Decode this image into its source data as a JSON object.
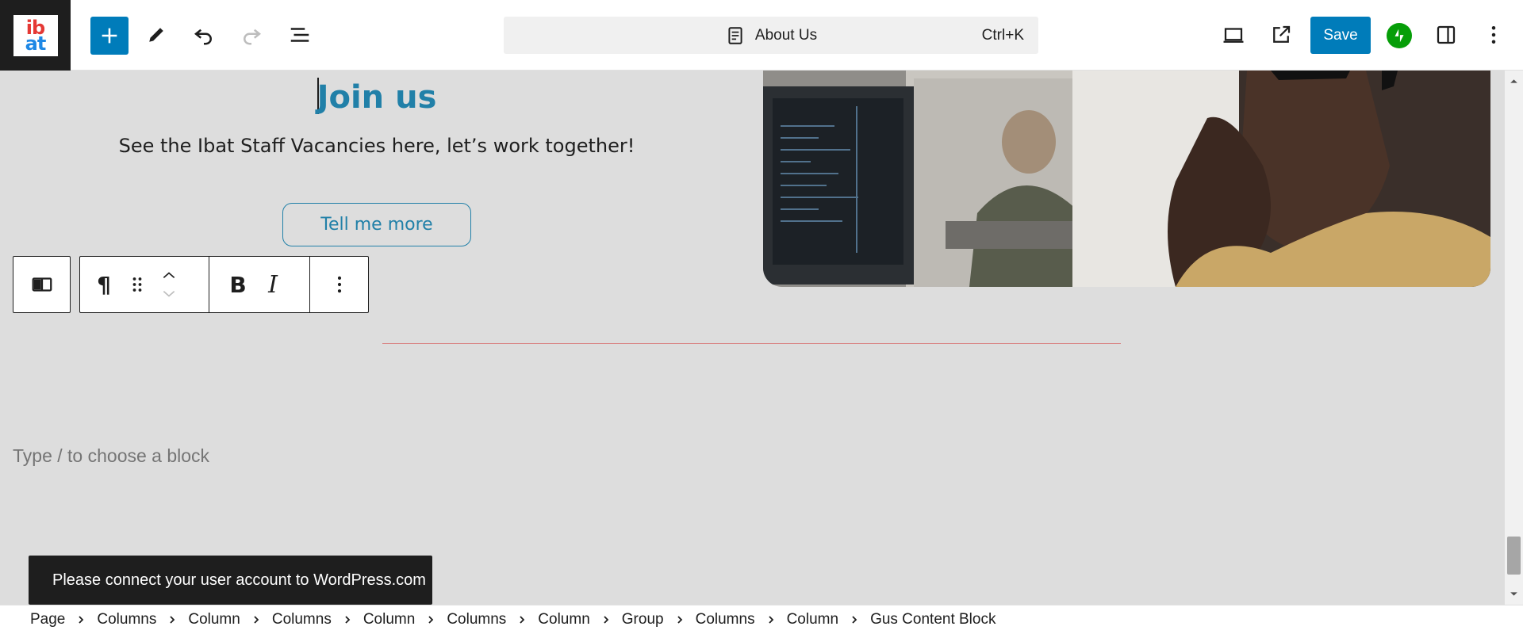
{
  "header": {
    "logo_text_top": "ib",
    "logo_text_bottom": "at",
    "add_block_icon": "plus-icon",
    "tools_icon": "pencil-icon",
    "undo_icon": "undo-icon",
    "redo_icon": "redo-icon",
    "document_overview_icon": "list-view-icon",
    "document_title": "About Us",
    "shortcut": "Ctrl+K",
    "view_icon": "desktop-icon",
    "preview_icon": "external-link-icon",
    "save_label": "Save",
    "jetpack_icon": "jetpack-icon",
    "settings_icon": "sidebar-icon",
    "options_icon": "more-vertical-icon"
  },
  "content": {
    "heading": "Join us",
    "subtext": "See the Ibat Staff Vacancies here, let’s work together!",
    "button_label": "Tell me more",
    "placeholder": "Type / to choose a block"
  },
  "block_toolbar": {
    "parent_icon": "columns-icon",
    "paragraph_icon": "pilcrow-icon",
    "paragraph_glyph": "¶",
    "drag_icon": "drag-handle-icon",
    "move_up_icon": "chevron-up-icon",
    "move_down_icon": "chevron-down-icon",
    "bold_label": "B",
    "italic_label": "I",
    "more_icon": "more-vertical-icon"
  },
  "snackbar": {
    "message": "Please connect your user account to WordPress.com"
  },
  "breadcrumb": {
    "items": [
      "Page",
      "Columns",
      "Column",
      "Columns",
      "Column",
      "Columns",
      "Column",
      "Group",
      "Columns",
      "Column",
      "Gus Content Block"
    ]
  },
  "colors": {
    "accent": "#007cba",
    "heading": "#2180a8",
    "canvas": "#dddddd",
    "divider": "#d98585",
    "jetpack": "#069e08"
  }
}
